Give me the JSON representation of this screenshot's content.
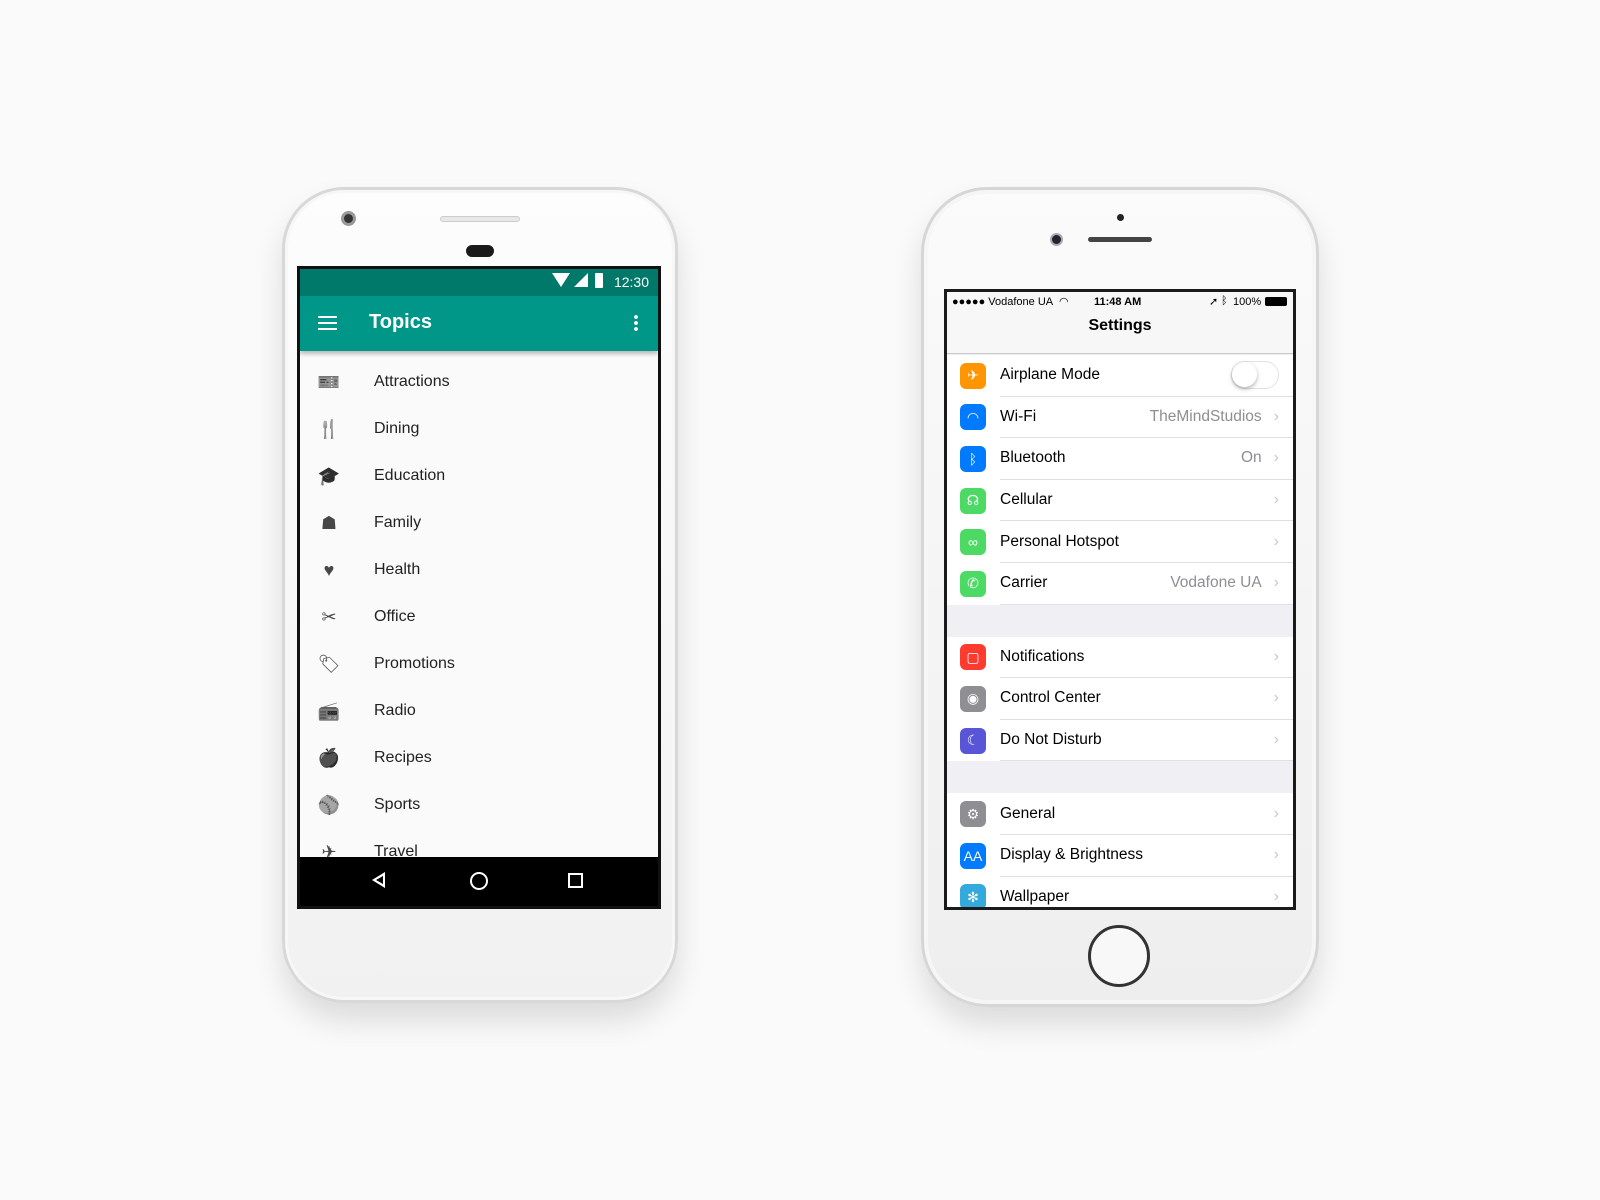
{
  "android": {
    "status": {
      "time": "12:30",
      "icons": [
        "wifi-icon",
        "signal-icon",
        "battery-icon"
      ]
    },
    "appbar": {
      "title": "Topics",
      "menu_icon": "hamburger-icon",
      "overflow_icon": "more-vert-icon",
      "color": "#009688"
    },
    "items": [
      {
        "label": "Attractions",
        "icon": "ticket-icon"
      },
      {
        "label": "Dining",
        "icon": "dining-icon"
      },
      {
        "label": "Education",
        "icon": "school-icon"
      },
      {
        "label": "Family",
        "icon": "family-icon"
      },
      {
        "label": "Health",
        "icon": "heart-icon"
      },
      {
        "label": "Office",
        "icon": "scissors-icon"
      },
      {
        "label": "Promotions",
        "icon": "tag-icon"
      },
      {
        "label": "Radio",
        "icon": "radio-icon"
      },
      {
        "label": "Recipes",
        "icon": "apple-icon"
      },
      {
        "label": "Sports",
        "icon": "ball-icon"
      },
      {
        "label": "Travel",
        "icon": "airplane-icon"
      }
    ],
    "nav": [
      "back-icon",
      "home-icon",
      "recents-icon"
    ]
  },
  "ios": {
    "status": {
      "carrier": "●●●●● Vodafone UA",
      "time": "11:48 AM",
      "battery": "100%"
    },
    "title": "Settings",
    "groups": [
      [
        {
          "label": "Airplane Mode",
          "color": "#ff9500",
          "glyph": "✈",
          "toggle": false
        },
        {
          "label": "Wi-Fi",
          "value": "TheMindStudios",
          "color": "#007aff",
          "glyph": "◠"
        },
        {
          "label": "Bluetooth",
          "value": "On",
          "color": "#007aff",
          "glyph": "ᛒ"
        },
        {
          "label": "Cellular",
          "value": "",
          "color": "#4cd964",
          "glyph": "☊"
        },
        {
          "label": "Personal Hotspot",
          "value": "",
          "color": "#4cd964",
          "glyph": "∞"
        },
        {
          "label": "Carrier",
          "value": "Vodafone UA",
          "color": "#4cd964",
          "glyph": "✆"
        }
      ],
      [
        {
          "label": "Notifications",
          "value": "",
          "color": "#ff3b30",
          "glyph": "▢"
        },
        {
          "label": "Control Center",
          "value": "",
          "color": "#8e8e93",
          "glyph": "◉"
        },
        {
          "label": "Do Not Disturb",
          "value": "",
          "color": "#5856d6",
          "glyph": "☾"
        }
      ],
      [
        {
          "label": "General",
          "value": "",
          "color": "#8e8e93",
          "glyph": "⚙"
        },
        {
          "label": "Display & Brightness",
          "value": "",
          "color": "#007aff",
          "glyph": "AA"
        },
        {
          "label": "Wallpaper",
          "value": "",
          "color": "#34aadc",
          "glyph": "✻"
        }
      ]
    ]
  }
}
